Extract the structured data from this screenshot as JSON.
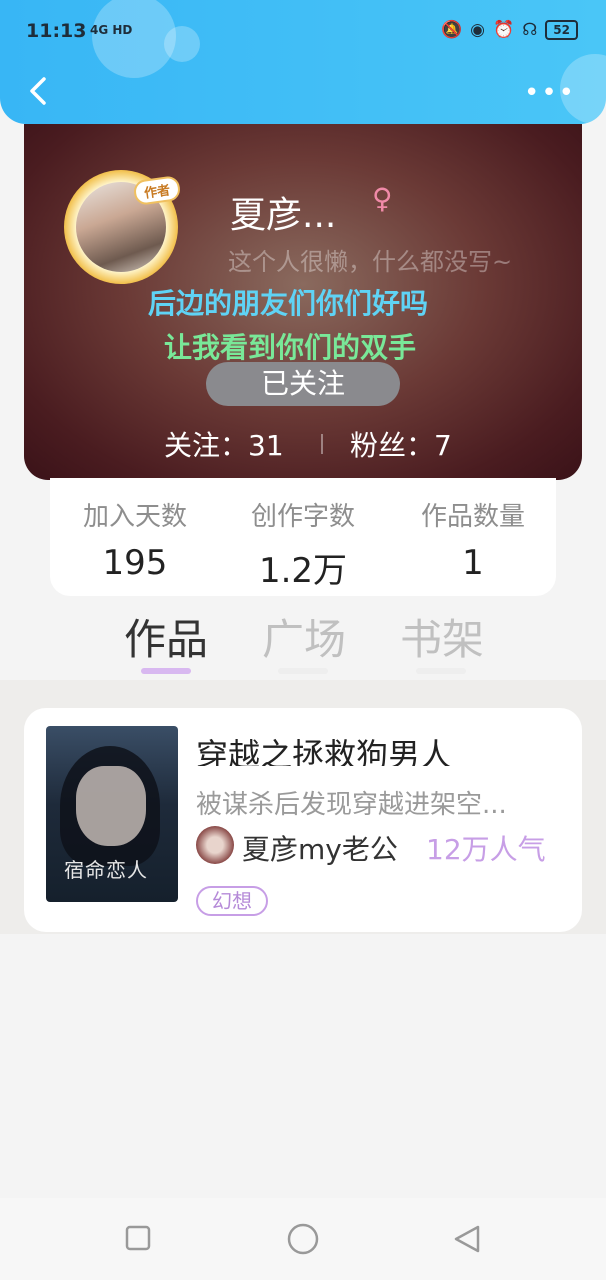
{
  "status_bar": {
    "time": "11:13",
    "network": "4G HD",
    "battery": "52"
  },
  "profile": {
    "author_badge": "作者",
    "username": "夏彦...",
    "gender_symbol": "♀",
    "bio": "这个人很懒，什么都没写~",
    "danmaku": [
      "后边的朋友们你们好吗",
      "让我看到你们的双手"
    ],
    "follow_button": "已关注",
    "following": "关注：31",
    "fans": "粉丝：7"
  },
  "stats": [
    {
      "label": "加入天数",
      "value": "195"
    },
    {
      "label": "创作字数",
      "value": "1.2万"
    },
    {
      "label": "作品数量",
      "value": "1"
    }
  ],
  "tabs": [
    {
      "label": "作品",
      "active": true
    },
    {
      "label": "广场",
      "active": false
    },
    {
      "label": "书架",
      "active": false
    }
  ],
  "book": {
    "cover_text": "宿命恋人",
    "title": "穿越之拯救狗男人",
    "description": "被谋杀后发现穿越进架空...",
    "author": "夏彦my老公",
    "popularity": "12万人气",
    "genre": "幻想"
  },
  "icons": {
    "back": "back-arrow-icon",
    "more": "more-icon",
    "nav_recent": "recent-apps-icon",
    "nav_home": "home-icon",
    "nav_back": "nav-back-icon"
  },
  "colors": {
    "header": "#38b6f5",
    "accent": "#c79ee6"
  }
}
